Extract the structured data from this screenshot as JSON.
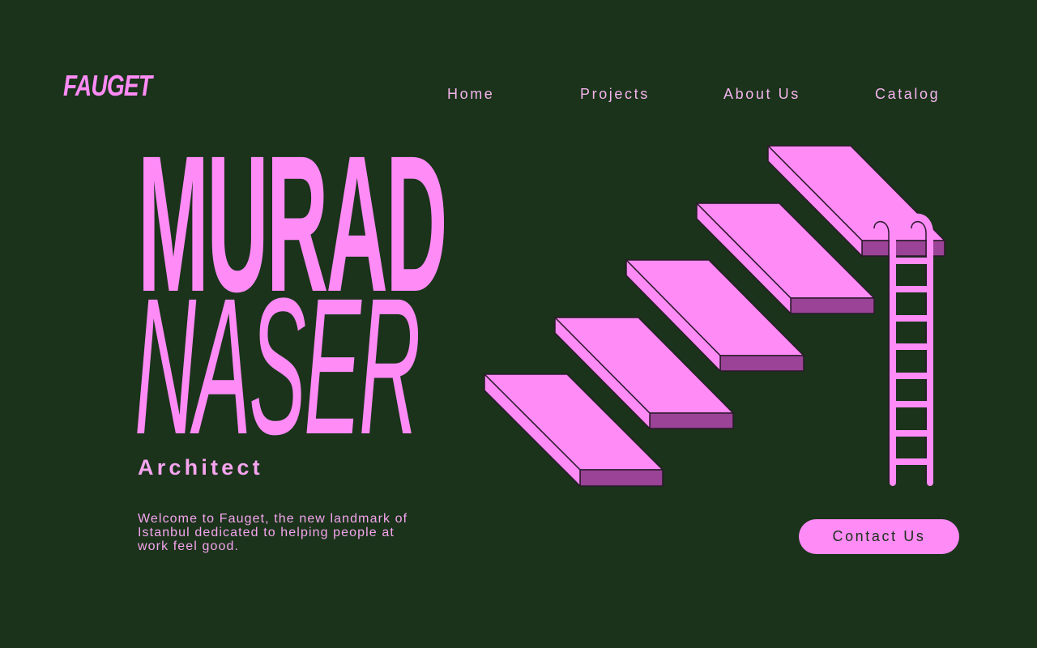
{
  "header": {
    "logo": "FAUGET",
    "nav": [
      {
        "label": "Home"
      },
      {
        "label": "Projects"
      },
      {
        "label": "About Us"
      },
      {
        "label": "Catalog"
      }
    ]
  },
  "hero": {
    "first_name": "MURAD",
    "last_name": "NASER",
    "role": "Architect",
    "intro": "Welcome to Fauget, the new landmark of Istanbul dedicated to helping people at work feel good.",
    "cta_label": "Contact Us"
  },
  "colors": {
    "background": "#1a331a",
    "accent": "#ff8bf6",
    "accent_shadow": "#9b4396",
    "text_soft": "#f6a4ef"
  },
  "icons": {
    "illustration": "floating-stairs-with-ladder"
  }
}
